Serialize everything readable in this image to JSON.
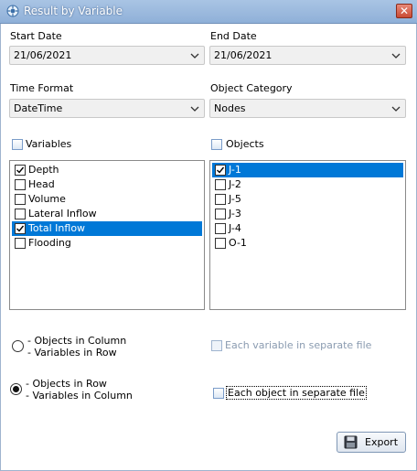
{
  "window": {
    "title": "Result by Variable",
    "close_label": "✕"
  },
  "start_date": {
    "label": "Start Date",
    "value": "21/06/2021"
  },
  "end_date": {
    "label": "End Date",
    "value": "21/06/2021"
  },
  "time_format": {
    "label": "Time Format",
    "value": "DateTime"
  },
  "object_category": {
    "label": "Object Category",
    "value": "Nodes"
  },
  "variables": {
    "header": "Variables",
    "header_checked": false,
    "items": [
      {
        "label": "Depth",
        "checked": true,
        "selected": false
      },
      {
        "label": "Head",
        "checked": false,
        "selected": false
      },
      {
        "label": "Volume",
        "checked": false,
        "selected": false
      },
      {
        "label": "Lateral Inflow",
        "checked": false,
        "selected": false
      },
      {
        "label": "Total Inflow",
        "checked": true,
        "selected": true
      },
      {
        "label": "Flooding",
        "checked": false,
        "selected": false
      }
    ]
  },
  "objects": {
    "header": "Objects",
    "header_checked": false,
    "items": [
      {
        "label": "J-1",
        "checked": true,
        "selected": true
      },
      {
        "label": "J-2",
        "checked": false,
        "selected": false
      },
      {
        "label": "J-5",
        "checked": false,
        "selected": false
      },
      {
        "label": "J-3",
        "checked": false,
        "selected": false
      },
      {
        "label": "J-4",
        "checked": false,
        "selected": false
      },
      {
        "label": "O-1",
        "checked": false,
        "selected": false
      }
    ]
  },
  "layout_options": {
    "option1": {
      "line1": "- Objects in Column",
      "line2": "- Variables in Row",
      "selected": false
    },
    "option2": {
      "line1": "- Objects in Row",
      "line2": "- Variables in Column",
      "selected": true
    }
  },
  "file_options": {
    "each_variable": {
      "label": "Each variable in separate file",
      "enabled": false,
      "checked": false
    },
    "each_object": {
      "label": "Each object in separate file",
      "enabled": true,
      "checked": false
    }
  },
  "export_button": {
    "label": "Export"
  },
  "colors": {
    "selection": "#0078d7",
    "titlebar": "#8fb0d8"
  }
}
